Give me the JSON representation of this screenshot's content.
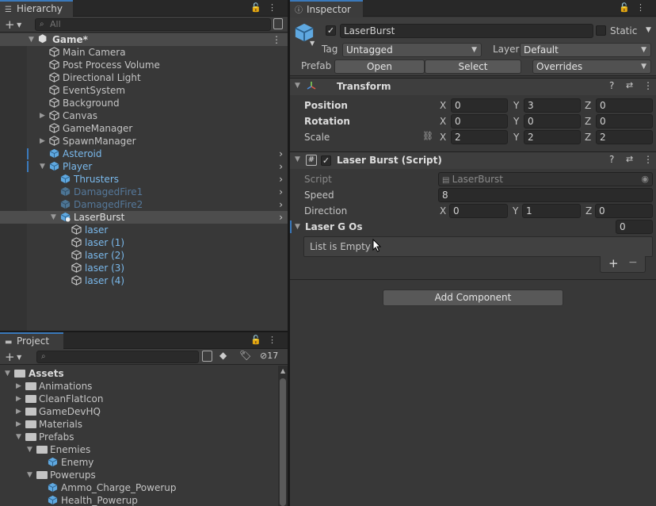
{
  "hierarchy": {
    "tab_label": "Hierarchy",
    "search_placeholder": "All",
    "scene_name": "Game*",
    "items": {
      "main_camera": "Main Camera",
      "post_process": "Post Process Volume",
      "directional_light": "Directional Light",
      "event_system": "EventSystem",
      "background": "Background",
      "canvas": "Canvas",
      "game_manager": "GameManager",
      "spawn_manager": "SpawnManager",
      "asteroid": "Asteroid",
      "player": "Player",
      "thrusters": "Thrusters",
      "damaged_fire1": "DamagedFire1",
      "damaged_fire2": "DamagedFire2",
      "laser_burst": "LaserBurst",
      "laser0": "laser",
      "laser1": "laser (1)",
      "laser2": "laser (2)",
      "laser3": "laser (3)",
      "laser4": "laser (4)"
    }
  },
  "project": {
    "tab_label": "Project",
    "hidden_count": "17",
    "tree": {
      "assets": "Assets",
      "animations": "Animations",
      "cleanflaticon": "CleanFlatIcon",
      "gamedevhq": "GameDevHQ",
      "materials": "Materials",
      "prefabs": "Prefabs",
      "enemies": "Enemies",
      "enemy": "Enemy",
      "powerups": "Powerups",
      "ammo": "Ammo_Charge_Powerup",
      "health": "Health_Powerup"
    }
  },
  "inspector": {
    "tab_label": "Inspector",
    "object_name": "LaserBurst",
    "static_label": "Static",
    "tag_label": "Tag",
    "tag_value": "Untagged",
    "layer_label": "Layer",
    "layer_value": "Default",
    "prefab_label": "Prefab",
    "open_label": "Open",
    "select_label": "Select",
    "overrides_label": "Overrides",
    "transform": {
      "title": "Transform",
      "position_label": "Position",
      "rotation_label": "Rotation",
      "scale_label": "Scale",
      "position": {
        "x": "0",
        "y": "3",
        "z": "0"
      },
      "rotation": {
        "x": "0",
        "y": "0",
        "z": "0"
      },
      "scale": {
        "x": "2",
        "y": "2",
        "z": "2"
      }
    },
    "script": {
      "title": "Laser Burst (Script)",
      "script_label": "Script",
      "script_value": "LaserBurst",
      "speed_label": "Speed",
      "speed_value": "8",
      "direction_label": "Direction",
      "direction": {
        "x": "0",
        "y": "1",
        "z": "0"
      },
      "list_label": "Laser G Os",
      "list_count": "0",
      "list_empty": "List is Empty",
      "add": "+",
      "remove": "−"
    },
    "add_component": "Add Component"
  },
  "axis": {
    "x": "X",
    "y": "Y",
    "z": "Z"
  }
}
